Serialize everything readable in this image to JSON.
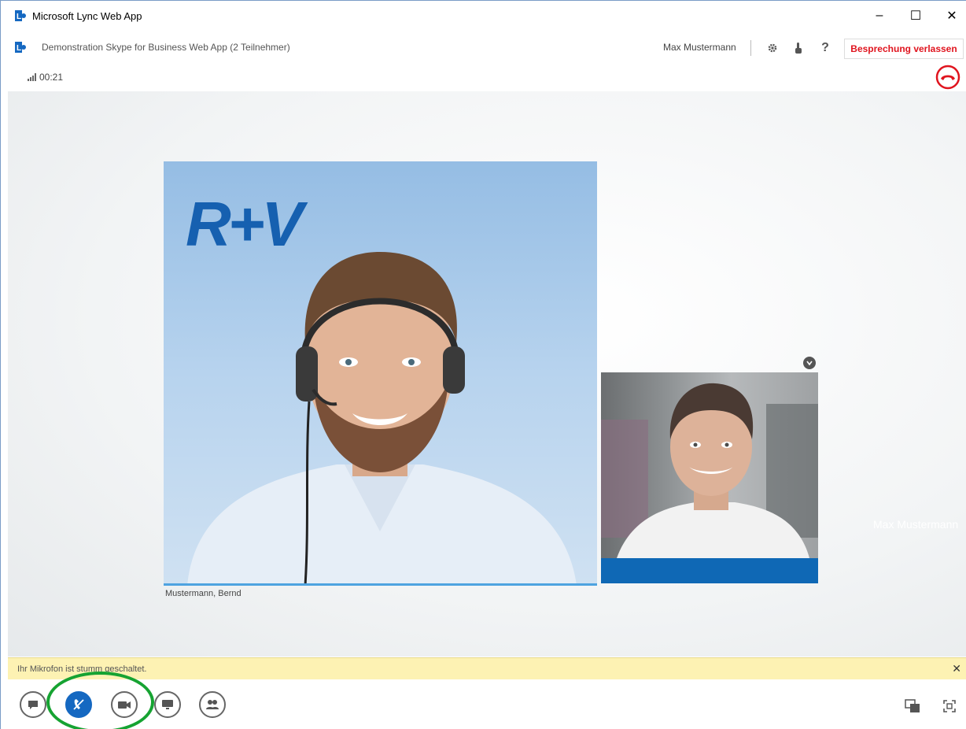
{
  "window": {
    "title": "Microsoft Lync Web App",
    "controls": {
      "minimize": "–",
      "maximize": "☐",
      "close": "✕"
    }
  },
  "conversation": {
    "title": "Demonstration Skype for Business Web App (2 Teilnehmer)",
    "user_name": "Max Mustermann",
    "leave_label": "Besprechung verlassen",
    "timer": "00:21",
    "signal_glyph": ".ıll",
    "help_glyph": "?"
  },
  "videos": {
    "main_caption": "Mustermann, Bernd",
    "main_logo_text": "R+V",
    "side_name": "Max Mustermann"
  },
  "notice": {
    "text": "Ihr Mikrofon ist stumm geschaltet.",
    "close": "✕"
  },
  "colors": {
    "accent": "#1568c1",
    "leave": "#e0141e",
    "highlight": "#16a332",
    "notice_bg": "#fdf2b3"
  },
  "icons": [
    "lync-logo-icon",
    "gear-icon",
    "touch-icon",
    "help-icon",
    "hangup-icon",
    "im-icon",
    "mic-muted-icon",
    "video-icon",
    "present-icon",
    "participants-icon",
    "layout-icon",
    "fullscreen-icon"
  ]
}
